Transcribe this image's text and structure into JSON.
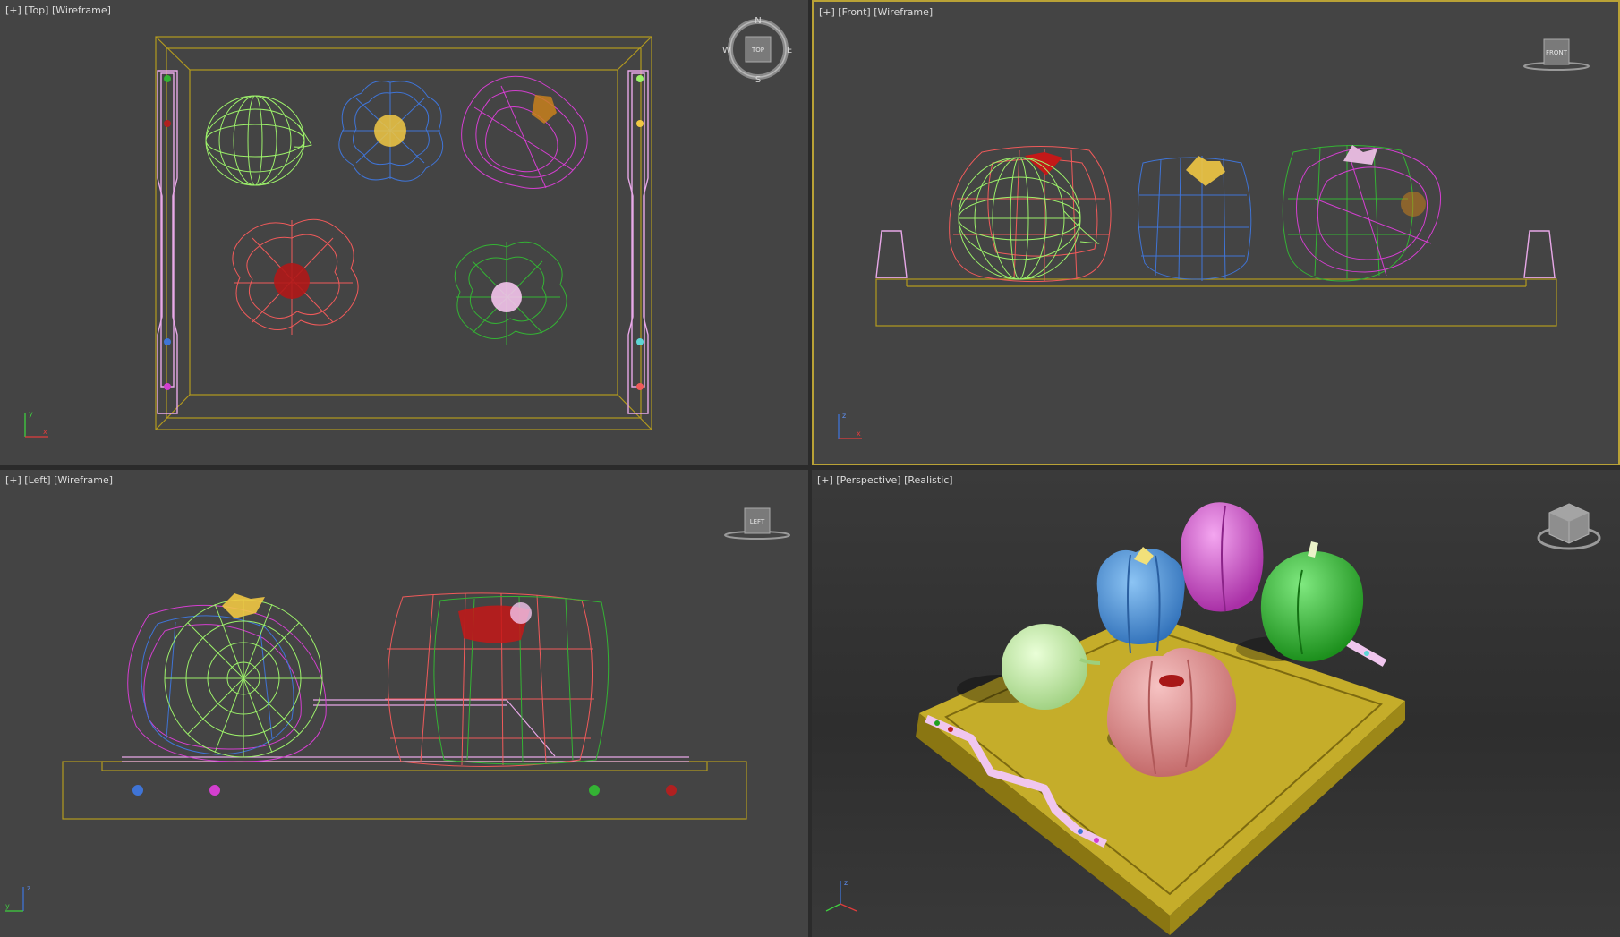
{
  "viewports": [
    {
      "id": "top",
      "label": "[+] [Top] [Wireframe]",
      "active": false
    },
    {
      "id": "front",
      "label": "[+] [Front] [Wireframe]",
      "active": true
    },
    {
      "id": "left",
      "label": "[+] [Left] [Wireframe]",
      "active": false
    },
    {
      "id": "perspective",
      "label": "[+] [Perspective] [Realistic]",
      "active": false
    }
  ],
  "viewcube": {
    "top_face": "TOP",
    "front_face": "FRONT",
    "left_face": "LEFT",
    "compass": {
      "n": "N",
      "s": "S",
      "e": "E",
      "w": "W"
    }
  },
  "axis_labels": {
    "x": "x",
    "y": "y",
    "z": "z"
  },
  "colors": {
    "viewport_bg": "#444444",
    "active_border": "#b9a236",
    "tray": "#b39a1e",
    "handle": "#e8a8e8",
    "onion": "#9cf06a",
    "pepper_blue": "#3f74d6",
    "pepper_magenta": "#d43fd0",
    "pepper_red": "#f05a5a",
    "pepper_green": "#34b334",
    "stem_yellow": "#f1c844"
  }
}
